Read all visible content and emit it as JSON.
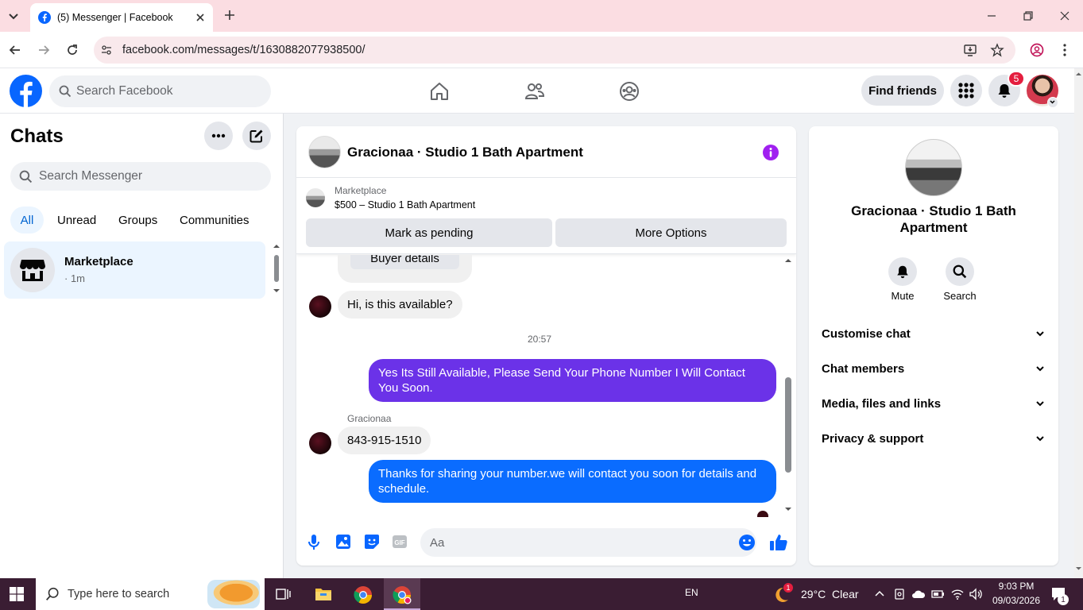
{
  "browser": {
    "tab_title": "(5) Messenger | Facebook",
    "url": "facebook.com/messages/t/1630882077938500/"
  },
  "header": {
    "search_placeholder": "Search Facebook",
    "find_friends": "Find friends",
    "notification_count": "5"
  },
  "sidebar": {
    "title": "Chats",
    "search_placeholder": "Search Messenger",
    "filters": [
      "All",
      "Unread",
      "Groups",
      "Communities"
    ],
    "chat": {
      "name": "Marketplace",
      "time": "· 1m"
    }
  },
  "conversation": {
    "title": "Gracionaa · Studio 1 Bath Apartment",
    "marketplace_label": "Marketplace",
    "listing": "$500 – Studio 1 Bath Apartment",
    "mark_pending": "Mark as pending",
    "more_options": "More Options",
    "buyer_details": "Buyer details",
    "messages": {
      "m1": "Hi, is this available?",
      "timestamp": "20:57",
      "m2": "Yes Its Still Available, Please Send Your Phone Number I Will Contact You Soon.",
      "sender": "Gracionaa",
      "m3": "843-915-1510",
      "m4": "Thanks for sharing your number.we will contact you soon for details and schedule."
    },
    "composer_placeholder": "Aa"
  },
  "info_panel": {
    "name": "Gracionaa · Studio 1 Bath Apartment",
    "mute": "Mute",
    "search": "Search",
    "rows": [
      "Customise chat",
      "Chat members",
      "Media, files and links",
      "Privacy & support"
    ]
  },
  "taskbar": {
    "search_placeholder": "Type here to search",
    "lang": "EN",
    "weather": "29°C  Clear",
    "time": "9:03 PM",
    "date": "09/03/2026",
    "notif": "1",
    "weather_badge": "1"
  },
  "colors": {
    "fb_blue": "#0866ff",
    "outgoing_purple": "#6b32e8",
    "outgoing_blue": "#0a6cff",
    "info_purple": "#a020f0",
    "notif_red": "#e41e3f"
  }
}
